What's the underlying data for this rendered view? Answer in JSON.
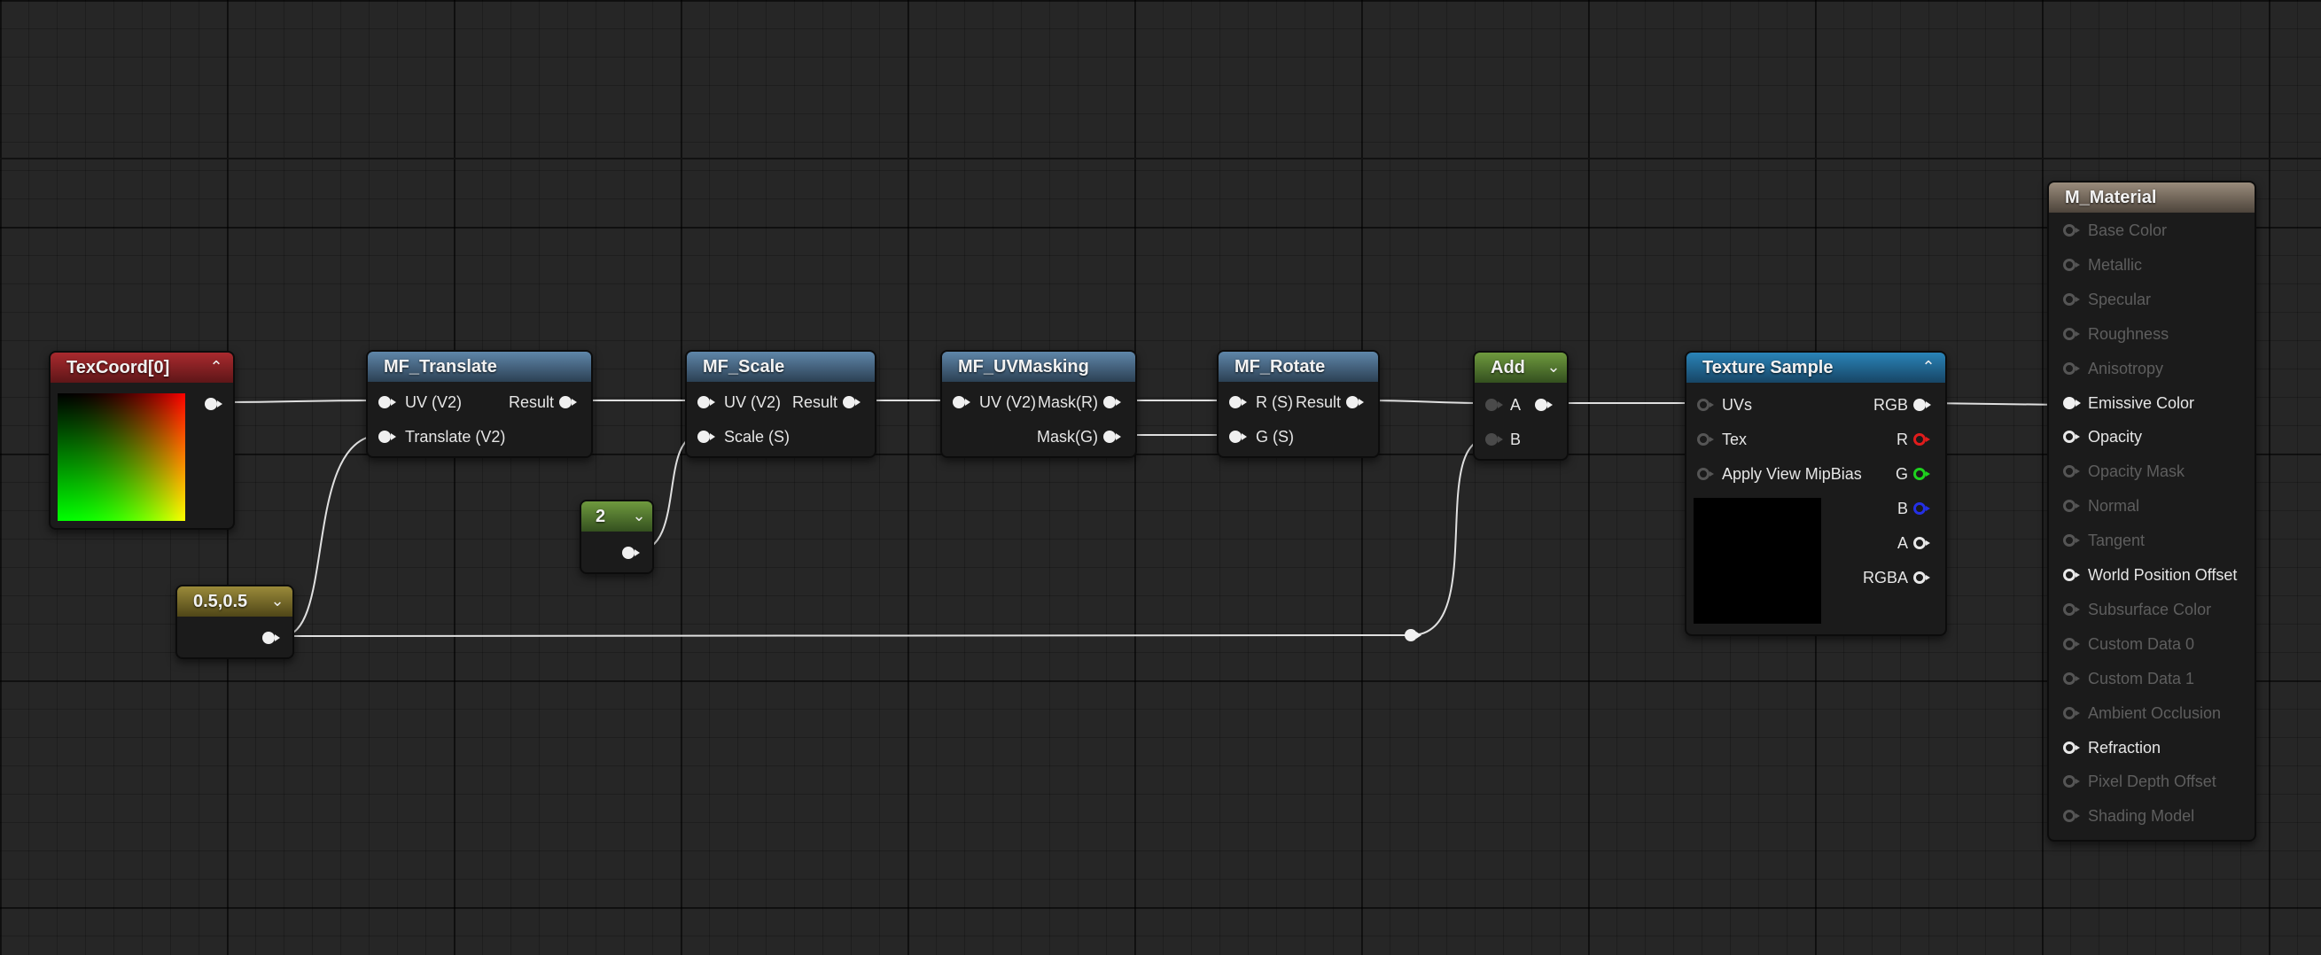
{
  "graph": {
    "nodes": {
      "texcoord": {
        "title": "TexCoord[0]"
      },
      "mf_translate": {
        "title": "MF_Translate",
        "inputs": [
          "UV (V2)",
          "Translate (V2)"
        ],
        "output": "Result"
      },
      "mf_scale": {
        "title": "MF_Scale",
        "inputs": [
          "UV (V2)",
          "Scale (S)"
        ],
        "output": "Result"
      },
      "mf_uvmasking": {
        "title": "MF_UVMasking",
        "input": "UV (V2)",
        "outputs": [
          "Mask(R)",
          "Mask(G)"
        ]
      },
      "mf_rotate": {
        "title": "MF_Rotate",
        "inputs": [
          "R (S)",
          "G (S)"
        ],
        "output": "Result"
      },
      "add": {
        "title": "Add",
        "inputs": [
          "A",
          "B"
        ]
      },
      "constant_scalar": {
        "value": "2"
      },
      "constant_vector": {
        "value": "0.5,0.5"
      },
      "texture_sample": {
        "title": "Texture Sample",
        "inputs": [
          "UVs",
          "Tex",
          "Apply View MipBias"
        ],
        "outputs": [
          "RGB",
          "R",
          "G",
          "B",
          "A",
          "RGBA"
        ]
      },
      "material": {
        "title": "M_Material",
        "inputs": [
          {
            "label": "Base Color",
            "active": false
          },
          {
            "label": "Metallic",
            "active": false
          },
          {
            "label": "Specular",
            "active": false
          },
          {
            "label": "Roughness",
            "active": false
          },
          {
            "label": "Anisotropy",
            "active": false
          },
          {
            "label": "Emissive Color",
            "active": true
          },
          {
            "label": "Opacity",
            "active": true
          },
          {
            "label": "Opacity Mask",
            "active": false
          },
          {
            "label": "Normal",
            "active": false
          },
          {
            "label": "Tangent",
            "active": false
          },
          {
            "label": "World Position Offset",
            "active": true
          },
          {
            "label": "Subsurface Color",
            "active": false
          },
          {
            "label": "Custom Data 0",
            "active": false
          },
          {
            "label": "Custom Data 1",
            "active": false
          },
          {
            "label": "Ambient Occlusion",
            "active": false
          },
          {
            "label": "Refraction",
            "active": true
          },
          {
            "label": "Pixel Depth Offset",
            "active": false
          },
          {
            "label": "Shading Model",
            "active": false
          }
        ]
      }
    },
    "colors": {
      "canvas": "#262626",
      "wire": "#e0e0e0",
      "header_red": "#a92a2e",
      "header_blue": "#5f86a9",
      "header_green": "#6f9a3e",
      "header_olive": "#9a8a3a",
      "header_texture": "#2a84b8",
      "header_material": "#9a8c7c"
    }
  }
}
